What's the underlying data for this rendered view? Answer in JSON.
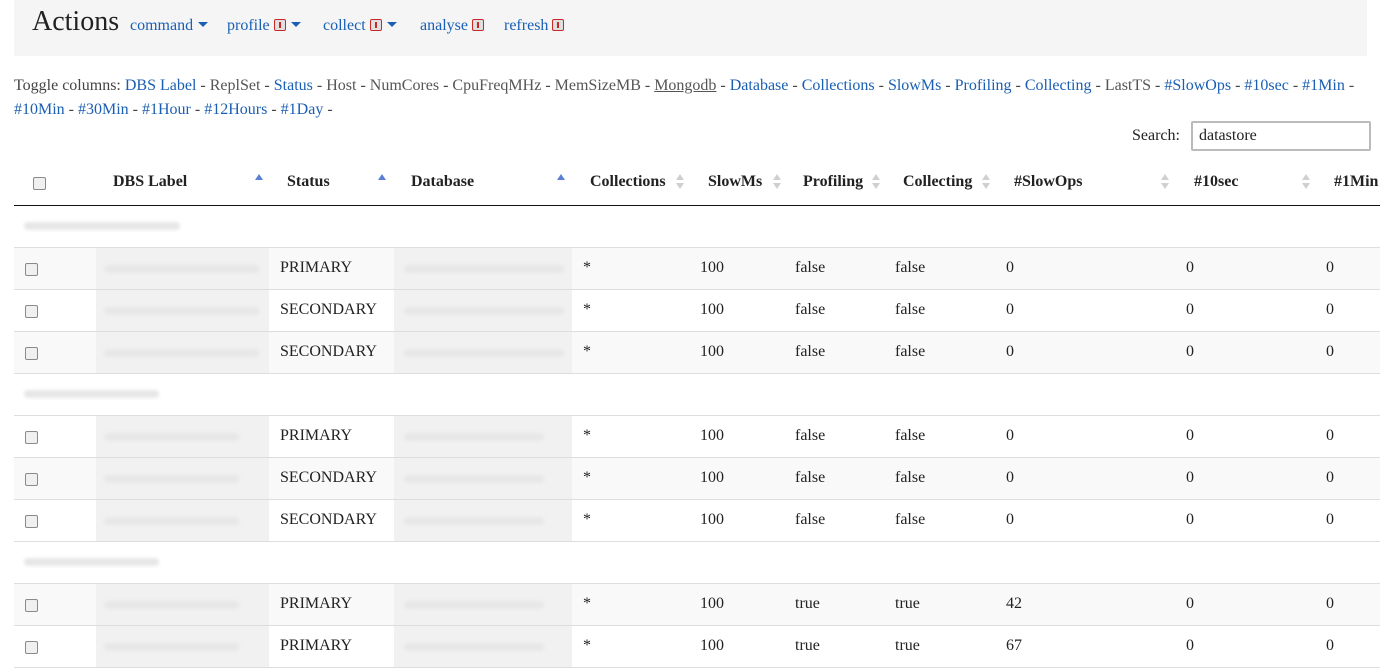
{
  "navbar": {
    "brand": "Actions",
    "menus": [
      {
        "label": "command",
        "dropdown": true,
        "info": false
      },
      {
        "label": "profile",
        "dropdown": true,
        "info": true
      },
      {
        "label": "collect",
        "dropdown": true,
        "info": true
      },
      {
        "label": "analyse",
        "dropdown": false,
        "info": true
      },
      {
        "label": "refresh",
        "dropdown": false,
        "info": true
      }
    ]
  },
  "toggle_columns": {
    "label": "Toggle columns:",
    "separator": " - ",
    "columns": [
      {
        "label": "DBS Label",
        "state": "visible"
      },
      {
        "label": "ReplSet",
        "state": "hidden"
      },
      {
        "label": "Status",
        "state": "visible"
      },
      {
        "label": "Host",
        "state": "hidden"
      },
      {
        "label": "NumCores",
        "state": "hidden"
      },
      {
        "label": "CpuFreqMHz",
        "state": "hidden"
      },
      {
        "label": "MemSizeMB",
        "state": "hidden"
      },
      {
        "label": "Mongodb",
        "state": "hovered"
      },
      {
        "label": "Database",
        "state": "visible"
      },
      {
        "label": "Collections",
        "state": "visible"
      },
      {
        "label": "SlowMs",
        "state": "visible"
      },
      {
        "label": "Profiling",
        "state": "visible"
      },
      {
        "label": "Collecting",
        "state": "visible"
      },
      {
        "label": "LastTS",
        "state": "hidden"
      },
      {
        "label": "#SlowOps",
        "state": "visible"
      },
      {
        "label": "#10sec",
        "state": "visible"
      },
      {
        "label": "#1Min",
        "state": "visible"
      },
      {
        "label": "#10Min",
        "state": "visible"
      },
      {
        "label": "#30Min",
        "state": "visible"
      },
      {
        "label": "#1Hour",
        "state": "visible"
      },
      {
        "label": "#12Hours",
        "state": "visible"
      },
      {
        "label": "#1Day",
        "state": "visible"
      }
    ]
  },
  "search": {
    "label": "Search:",
    "value": "datastore"
  },
  "table": {
    "columns": [
      {
        "label": "DBS Label",
        "sort": "asc"
      },
      {
        "label": "Status",
        "sort": "asc"
      },
      {
        "label": "Database",
        "sort": "asc"
      },
      {
        "label": "Collections",
        "sort": "none"
      },
      {
        "label": "SlowMs",
        "sort": "none"
      },
      {
        "label": "Profiling",
        "sort": "none"
      },
      {
        "label": "Collecting",
        "sort": "none"
      },
      {
        "label": "#SlowOps",
        "sort": "none"
      },
      {
        "label": "#10sec",
        "sort": "none"
      },
      {
        "label": "#1Min",
        "sort": "none"
      }
    ],
    "groups": [
      {
        "rows": [
          {
            "status": "PRIMARY",
            "collections": "*",
            "slowms": "100",
            "profiling": "false",
            "collecting": "false",
            "slowops": "0",
            "sec10": "0",
            "min1": "0"
          },
          {
            "status": "SECONDARY",
            "collections": "*",
            "slowms": "100",
            "profiling": "false",
            "collecting": "false",
            "slowops": "0",
            "sec10": "0",
            "min1": "0"
          },
          {
            "status": "SECONDARY",
            "collections": "*",
            "slowms": "100",
            "profiling": "false",
            "collecting": "false",
            "slowops": "0",
            "sec10": "0",
            "min1": "0"
          }
        ]
      },
      {
        "rows": [
          {
            "status": "PRIMARY",
            "collections": "*",
            "slowms": "100",
            "profiling": "false",
            "collecting": "false",
            "slowops": "0",
            "sec10": "0",
            "min1": "0"
          },
          {
            "status": "SECONDARY",
            "collections": "*",
            "slowms": "100",
            "profiling": "false",
            "collecting": "false",
            "slowops": "0",
            "sec10": "0",
            "min1": "0"
          },
          {
            "status": "SECONDARY",
            "collections": "*",
            "slowms": "100",
            "profiling": "false",
            "collecting": "false",
            "slowops": "0",
            "sec10": "0",
            "min1": "0"
          }
        ]
      },
      {
        "rows": [
          {
            "status": "PRIMARY",
            "collections": "*",
            "slowms": "100",
            "profiling": "true",
            "collecting": "true",
            "slowops": "42",
            "sec10": "0",
            "min1": "0"
          },
          {
            "status": "PRIMARY",
            "collections": "*",
            "slowms": "100",
            "profiling": "true",
            "collecting": "true",
            "slowops": "67",
            "sec10": "0",
            "min1": "0"
          }
        ]
      }
    ]
  }
}
